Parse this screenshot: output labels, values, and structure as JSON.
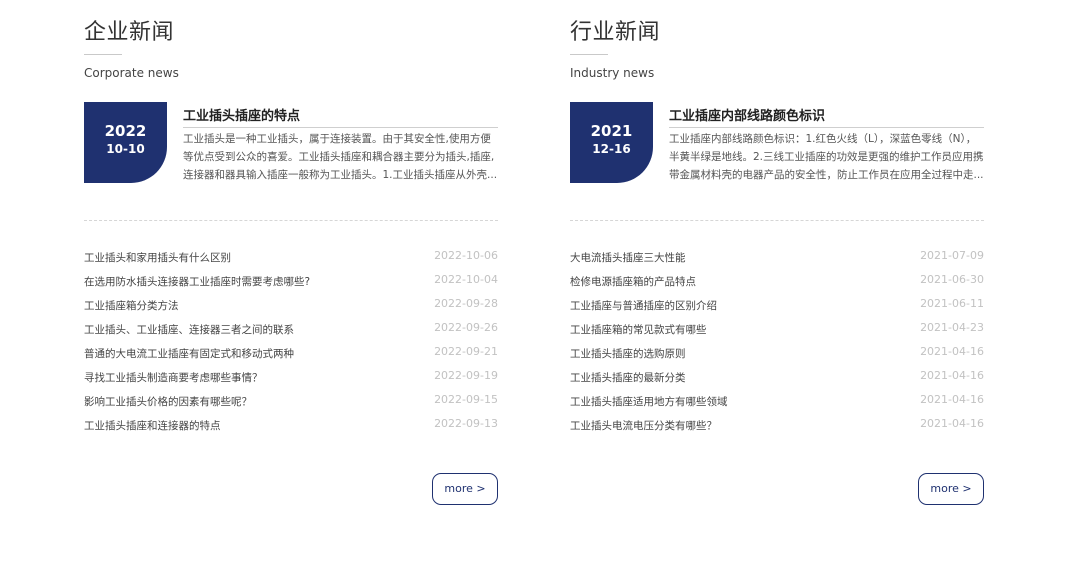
{
  "company": {
    "title": "企业新闻",
    "subtitle": "Corporate news",
    "featured": {
      "year": "2022",
      "month_day": "10-10",
      "title": "工业插头插座的特点",
      "desc": "工业插头是一种工业插头，属于连接装置。由于其安全性,使用方便等优点受到公众的喜爱。工业插头插座和耦合器主要分为插头,插座,连接器和器具输入插座一般称为工业插头。1.工业插头插座从外壳..."
    },
    "items": [
      {
        "text": "工业插头和家用插头有什么区别",
        "date": "2022-10-06"
      },
      {
        "text": "在选用防水插头连接器工业插座时需要考虑哪些?",
        "date": "2022-10-04"
      },
      {
        "text": "工业插座箱分类方法",
        "date": "2022-09-28"
      },
      {
        "text": "工业插头、工业插座、连接器三者之间的联系",
        "date": "2022-09-26"
      },
      {
        "text": "普通的大电流工业插座有固定式和移动式两种",
        "date": "2022-09-21"
      },
      {
        "text": "寻找工业插头制造商要考虑哪些事情？",
        "date": "2022-09-19"
      },
      {
        "text": "影响工业插头价格的因素有哪些呢？",
        "date": "2022-09-15"
      },
      {
        "text": "工业插头插座和连接器的特点",
        "date": "2022-09-13"
      }
    ],
    "more_label": "more >"
  },
  "industry": {
    "title": "行业新闻",
    "subtitle": "Industry news",
    "featured": {
      "year": "2021",
      "month_day": "12-16",
      "title": "工业插座内部线路颜色标识",
      "desc": "工业插座内部线路颜色标识：1.红色火线（L），深蓝色零线（N），半黄半绿是地线。2.三线工业插座的功效是更强的维护工作员应用携带金属材料壳的电器产品的安全性，防止工作员在应用全过程中走..."
    },
    "items": [
      {
        "text": "大电流插头插座三大性能",
        "date": "2021-07-09"
      },
      {
        "text": "检修电源插座箱的产品特点",
        "date": "2021-06-30"
      },
      {
        "text": "工业插座与普通插座的区别介绍",
        "date": "2021-06-11"
      },
      {
        "text": "工业插座箱的常见款式有哪些",
        "date": "2021-04-23"
      },
      {
        "text": "工业插头插座的选购原则",
        "date": "2021-04-16"
      },
      {
        "text": "工业插头插座的最新分类",
        "date": "2021-04-16"
      },
      {
        "text": "工业插头插座适用地方有哪些领域",
        "date": "2021-04-16"
      },
      {
        "text": "工业插头电流电压分类有哪些？",
        "date": "2021-04-16"
      }
    ],
    "more_label": "more >"
  },
  "colors": {
    "accent": "#1f3170",
    "date_text": "#c2c2c2"
  }
}
